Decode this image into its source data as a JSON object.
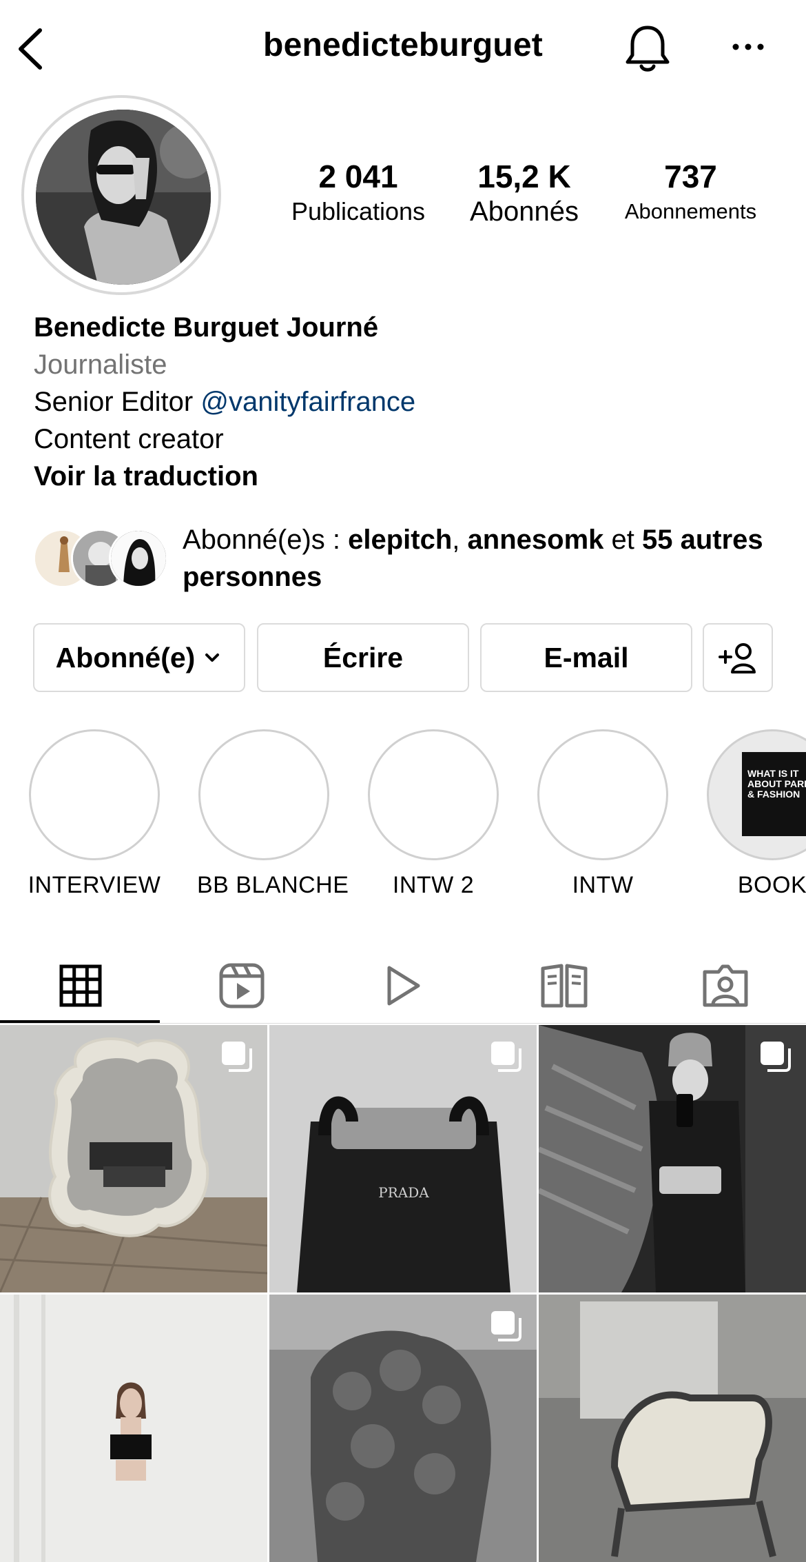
{
  "header": {
    "username": "benedicteburguet"
  },
  "stats": {
    "posts": {
      "value": "2 041",
      "label": "Publications"
    },
    "followers": {
      "value": "15,2 K",
      "label": "Abonnés"
    },
    "following": {
      "value": "737",
      "label": "Abonnements"
    }
  },
  "bio": {
    "name": "Benedicte Burguet Journé",
    "category": "Journaliste",
    "line1_prefix": "Senior Editor ",
    "line1_mention": "@vanityfairfrance",
    "line2": "Content creator",
    "translate": "Voir la traduction"
  },
  "followed_by": {
    "prefix": "Abonné(e)s : ",
    "user1": "elepitch",
    "sep": ", ",
    "user2": "annesomk",
    "and": " et ",
    "others": "55 autres personnes"
  },
  "buttons": {
    "following": "Abonné(e)",
    "message": "Écrire",
    "email": "E-mail"
  },
  "highlights": [
    {
      "label": "INTERVIEW"
    },
    {
      "label": "BB BLANCHE"
    },
    {
      "label": "INTW 2"
    },
    {
      "label": "INTW"
    },
    {
      "label": "BOOK"
    }
  ],
  "book_cover": {
    "title_line1": "WHAT IS IT",
    "title_line2": "ABOUT PARIS",
    "title_line3": "& FASHION"
  },
  "post_bag_text": "PRADA",
  "tabs": [
    {
      "icon": "grid-icon"
    },
    {
      "icon": "reels-icon"
    },
    {
      "icon": "play-icon"
    },
    {
      "icon": "guides-icon"
    },
    {
      "icon": "tagged-icon"
    }
  ],
  "colors": {
    "mention": "#00376b",
    "secondary_text": "#737373",
    "border": "#dbdbdb"
  }
}
